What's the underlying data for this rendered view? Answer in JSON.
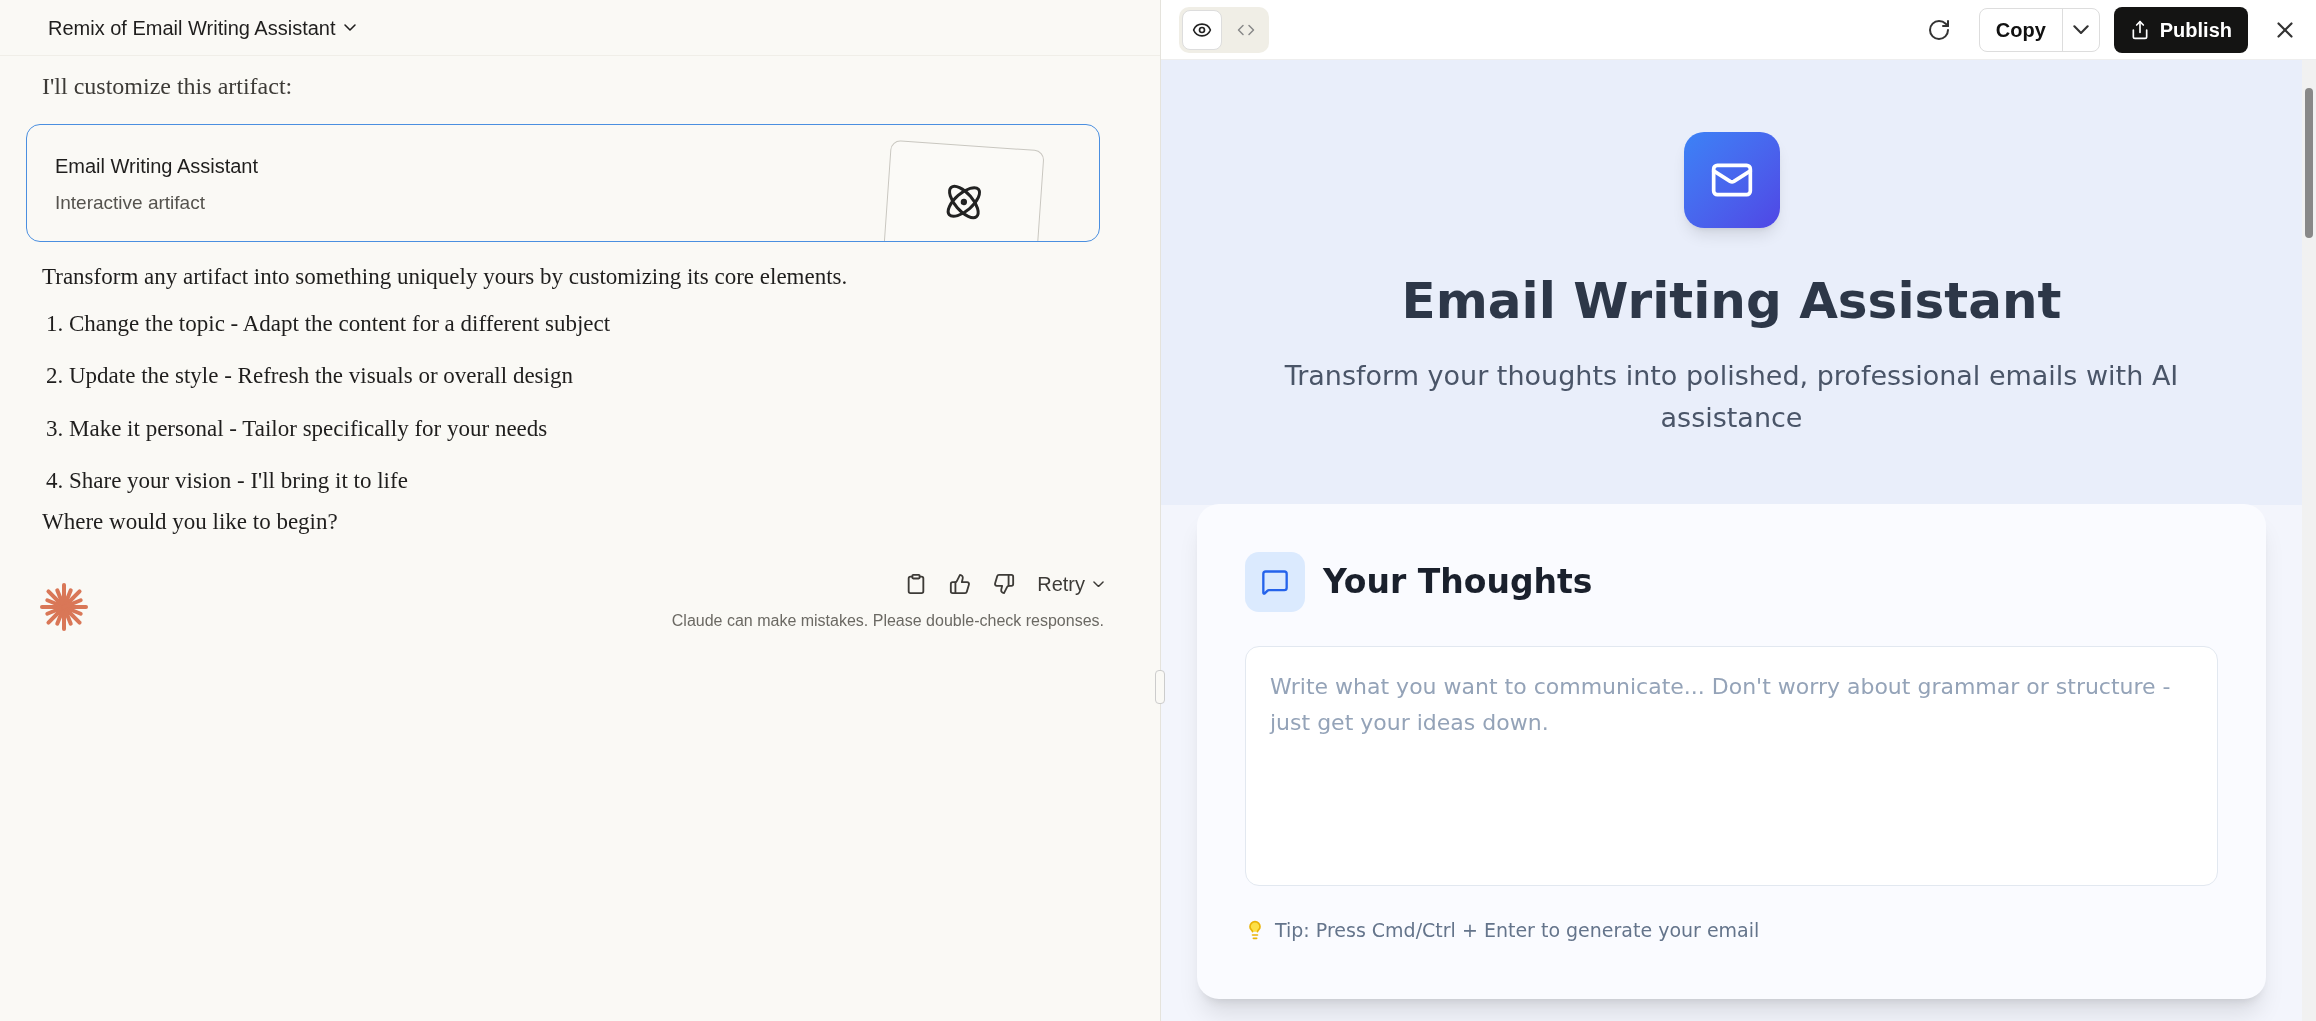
{
  "chat": {
    "title": "Remix of Email Writing Assistant",
    "intro": "I'll customize this artifact:",
    "artifact": {
      "title": "Email Writing Assistant",
      "subtitle": "Interactive artifact"
    },
    "lead": "Transform any artifact into something uniquely yours by customizing its core elements.",
    "steps": [
      {
        "number": "1.",
        "text": "Change the topic - Adapt the content for a different subject"
      },
      {
        "number": "2.",
        "text": "Update the style - Refresh the visuals or overall design"
      },
      {
        "number": "3.",
        "text": "Make it personal - Tailor specifically for your needs"
      },
      {
        "number": "4.",
        "text": "Share your vision - I'll bring it to life"
      }
    ],
    "question": "Where would you like to begin?",
    "retry": "Retry",
    "disclaimer": "Claude can make mistakes. Please double-check responses."
  },
  "preview": {
    "view_tabs": [
      {
        "kind": "preview",
        "selected": true
      },
      {
        "kind": "code",
        "selected": false
      }
    ],
    "copy": "Copy",
    "publish": "Publish",
    "app": {
      "title": "Email Writing Assistant",
      "subtitle": "Transform your thoughts into polished, professional emails with AI assistance",
      "section": "Your Thoughts",
      "placeholder": "Write what you want to communicate... Don't worry about grammar or structure - just get your ideas down.",
      "tip": "Tip: Press Cmd/Ctrl + Enter to generate your email"
    }
  }
}
